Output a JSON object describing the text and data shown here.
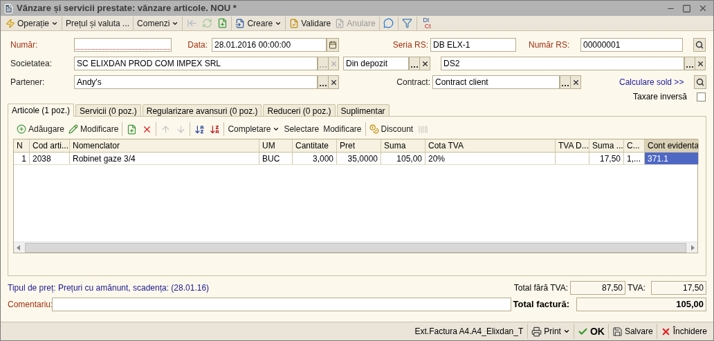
{
  "window": {
    "title": "Vânzare și servicii prestate: vânzare articole. NOU *"
  },
  "toolbar": [
    [
      {
        "kind": "button",
        "label": "Operație",
        "dropdown": true,
        "disabled": false
      }
    ],
    [
      {
        "kind": "button",
        "label": "Prețul și valuta ...",
        "disabled": false
      }
    ],
    [
      {
        "kind": "button",
        "label": "Comenzi",
        "dropdown": true,
        "disabled": false
      }
    ],
    [
      {
        "kind": "icon",
        "disabled": true
      },
      {
        "kind": "icon",
        "disabled": true
      },
      {
        "kind": "icon",
        "disabled": false
      }
    ],
    [
      {
        "kind": "button",
        "label": "Creare",
        "dropdown": true,
        "disabled": false
      }
    ],
    [
      {
        "kind": "button",
        "label": "Validare",
        "disabled": false
      },
      {
        "kind": "button",
        "label": "Anulare",
        "disabled": true
      }
    ],
    [
      {
        "kind": "icon",
        "disabled": false
      }
    ],
    [
      {
        "kind": "icon",
        "disabled": false
      }
    ],
    [
      {
        "kind": "dtct",
        "top": "Dt",
        "bottom": "Ct",
        "disabled": false
      }
    ]
  ],
  "form": {
    "numar": {
      "label": "Număr:",
      "required": true
    },
    "data": {
      "label": "Data:",
      "required": true,
      "value": "28.01.2016 00:00:00"
    },
    "seria_rs": {
      "label": "Seria RS:",
      "required": true,
      "value": "DB ELX-1"
    },
    "numar_rs": {
      "label": "Număr RS:",
      "required": true,
      "value": "00000001"
    },
    "societatea": {
      "label": "Societatea:",
      "required": false,
      "value": "SC ELIXDAN PROD COM IMPEX SRL",
      "disabled": true
    },
    "sursa": {
      "value": "Din depozit",
      "disabled": false
    },
    "depozit": {
      "value": "DS2",
      "disabled": false
    },
    "partener": {
      "label": "Partener:",
      "required": false,
      "value": "Andy's",
      "disabled": false
    },
    "contract": {
      "label": "Contract:",
      "required": false,
      "value": "Contract client",
      "disabled": false
    },
    "balance_link": "Calculare sold >>",
    "reverse_charge": {
      "label": "Taxare inversă",
      "checked": false
    }
  },
  "tabs": [
    {
      "label": "Articole (1 poz.)",
      "selected": true
    },
    {
      "label": "Servicii (0 poz.)",
      "selected": false
    },
    {
      "label": "Regularizare avansuri (0 poz.)",
      "selected": false
    },
    {
      "label": "Reduceri (0 poz.)",
      "selected": false
    },
    {
      "label": "Suplimentar",
      "selected": false
    }
  ],
  "grid_toolbar": [
    [
      {
        "kind": "button",
        "label": "Adăugare",
        "disabled": false
      },
      {
        "kind": "button",
        "label": "Modificare",
        "disabled": false
      }
    ],
    [
      {
        "kind": "icon",
        "disabled": false
      },
      {
        "kind": "icon",
        "disabled": false
      }
    ],
    [
      {
        "kind": "icon",
        "disabled": true
      },
      {
        "kind": "icon",
        "disabled": true
      }
    ],
    [
      {
        "kind": "icon",
        "disabled": false
      },
      {
        "kind": "icon",
        "disabled": false
      }
    ],
    [
      {
        "kind": "button",
        "label": "Completare",
        "dropdown": true,
        "disabled": false
      },
      {
        "kind": "button",
        "label": "Selectare",
        "disabled": false
      },
      {
        "kind": "button",
        "label": "Modificare",
        "disabled": false
      }
    ],
    [
      {
        "kind": "button",
        "label": "Discount",
        "disabled": false
      },
      {
        "kind": "icon",
        "disabled": true
      }
    ]
  ],
  "table": {
    "columns": [
      {
        "label": "N",
        "selected": false
      },
      {
        "label": "Cod arti...",
        "selected": false
      },
      {
        "label": "Nomenclator",
        "selected": false
      },
      {
        "label": "UM",
        "selected": false
      },
      {
        "label": "Cantitate",
        "selected": false
      },
      {
        "label": "Pret",
        "selected": false
      },
      {
        "label": "Suma",
        "selected": false
      },
      {
        "label": "Cota TVA",
        "selected": false
      },
      {
        "label": "TVA D...",
        "selected": false
      },
      {
        "label": "Suma ...",
        "selected": false
      },
      {
        "label": "C...",
        "selected": false
      },
      {
        "label": "Cont evidenta",
        "selected": true
      }
    ],
    "rows": [
      {
        "selected": true,
        "cells": [
          "1",
          "2038",
          "Robinet gaze 3/4",
          "BUC",
          "3,000",
          "35,0000",
          "105,00",
          "20%",
          "",
          "17,50",
          "1,...",
          "371.1"
        ]
      }
    ]
  },
  "footer": {
    "price_info": "Tipul de preț: Prețuri cu amănunt, scadența:  (28.01.16)",
    "comment": {
      "label": "Comentariu:",
      "required": true
    },
    "total_net": {
      "label": "Total fără TVA:",
      "value": "87,50"
    },
    "vat": {
      "label": "TVA:",
      "value": "17,50"
    },
    "total": {
      "label": "Total factură:",
      "value": "105,00"
    }
  },
  "status_bar": {
    "print_form": "Ext.Factura A4.A4_Elixdan_T",
    "buttons": [
      {
        "label": "Print",
        "dropdown": true,
        "bold": false
      },
      {
        "label": "OK",
        "bold": true
      },
      {
        "label": "Salvare",
        "bold": false
      },
      {
        "label": "Închidere",
        "bold": false
      }
    ]
  }
}
